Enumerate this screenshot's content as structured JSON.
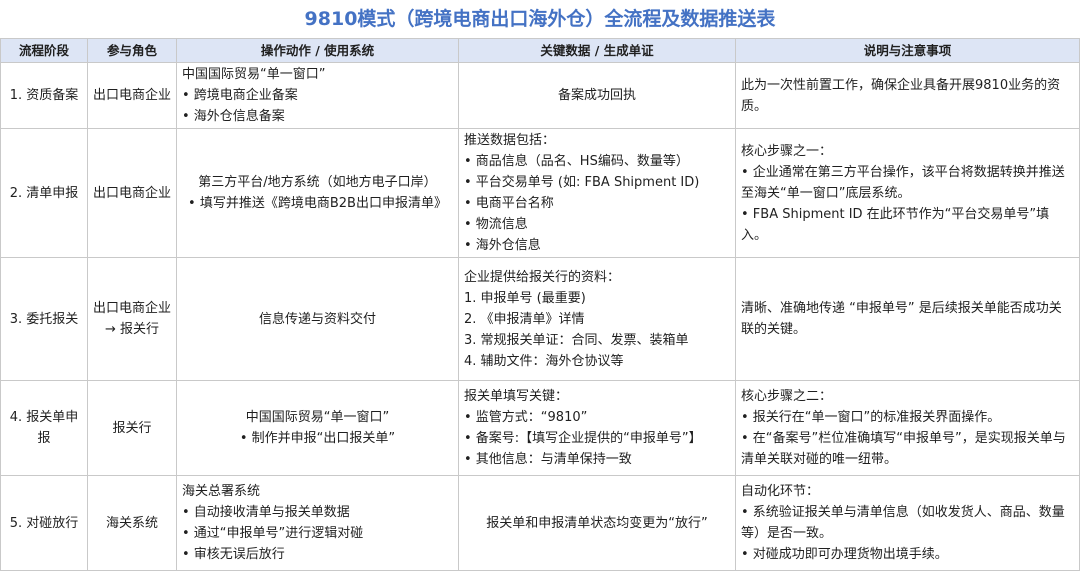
{
  "title": "9810模式（跨境电商出口海外仓）全流程及数据推送表",
  "headers": [
    "流程阶段",
    "参与角色",
    "操作动作 / 使用系统",
    "关键数据 / 生成单证",
    "说明与注意事项"
  ],
  "rows": [
    {
      "stage": "1. 资质备案",
      "role": [
        "出口电商企业"
      ],
      "action": [
        "中国国际贸易“单一窗口”",
        "• 跨境电商企业备案",
        "• 海外仓信息备案"
      ],
      "data": [
        "备案成功回执"
      ],
      "notes": [
        "此为一次性前置工作，确保企业具备开展9810业务的资质。"
      ]
    },
    {
      "stage": "2. 清单申报",
      "role": [
        "出口电商企业"
      ],
      "action": [
        "第三方平台/地方系统（如地方电子口岸）",
        "• 填写并推送《跨境电商B2B出口申报清单》"
      ],
      "data": [
        "推送数据包括：",
        "• 商品信息（品名、HS编码、数量等）",
        "• 平台交易单号 (如: FBA Shipment ID)",
        "• 电商平台名称",
        "• 物流信息",
        "• 海外仓信息"
      ],
      "notes": [
        "核心步骤之一：",
        "• 企业通常在第三方平台操作，该平台将数据转换并推送至海关“单一窗口”底层系统。",
        "• FBA Shipment ID 在此环节作为“平台交易单号”填入。"
      ]
    },
    {
      "stage": "3. 委托报关",
      "role": [
        "出口电商企业",
        "→ 报关行"
      ],
      "action": [
        "信息传递与资料交付"
      ],
      "data": [
        "企业提供给报关行的资料：",
        "1. 申报单号 (最重要)",
        "2. 《申报清单》详情",
        "3. 常规报关单证：合同、发票、装箱单",
        "4. 辅助文件：海外仓协议等"
      ],
      "notes": [
        "清晰、准确地传递 “申报单号” 是后续报关单能否成功关联的关键。"
      ]
    },
    {
      "stage": "4. 报关单申报",
      "role": [
        "报关行"
      ],
      "action": [
        "中国国际贸易“单一窗口”",
        "• 制作并申报“出口报关单”"
      ],
      "data": [
        "报关单填写关键：",
        "• 监管方式：“9810”",
        "• 备案号:【填写企业提供的“申报单号”】",
        "• 其他信息：与清单保持一致"
      ],
      "notes": [
        "核心步骤之二：",
        "• 报关行在“单一窗口”的标准报关界面操作。",
        "• 在“备案号”栏位准确填写“申报单号”，是实现报关单与清单关联对碰的唯一纽带。"
      ]
    },
    {
      "stage": "5. 对碰放行",
      "role": [
        "海关系统"
      ],
      "action": [
        "海关总署系统",
        "• 自动接收清单与报关单数据",
        "• 通过“申报单号”进行逻辑对碰",
        "• 审核无误后放行"
      ],
      "data": [
        "报关单和申报清单状态均变更为“放行”"
      ],
      "notes": [
        "自动化环节：",
        "• 系统验证报关单与清单信息（如收发货人、商品、数量等）是否一致。",
        "• 对碰成功即可办理货物出境手续。"
      ]
    }
  ]
}
